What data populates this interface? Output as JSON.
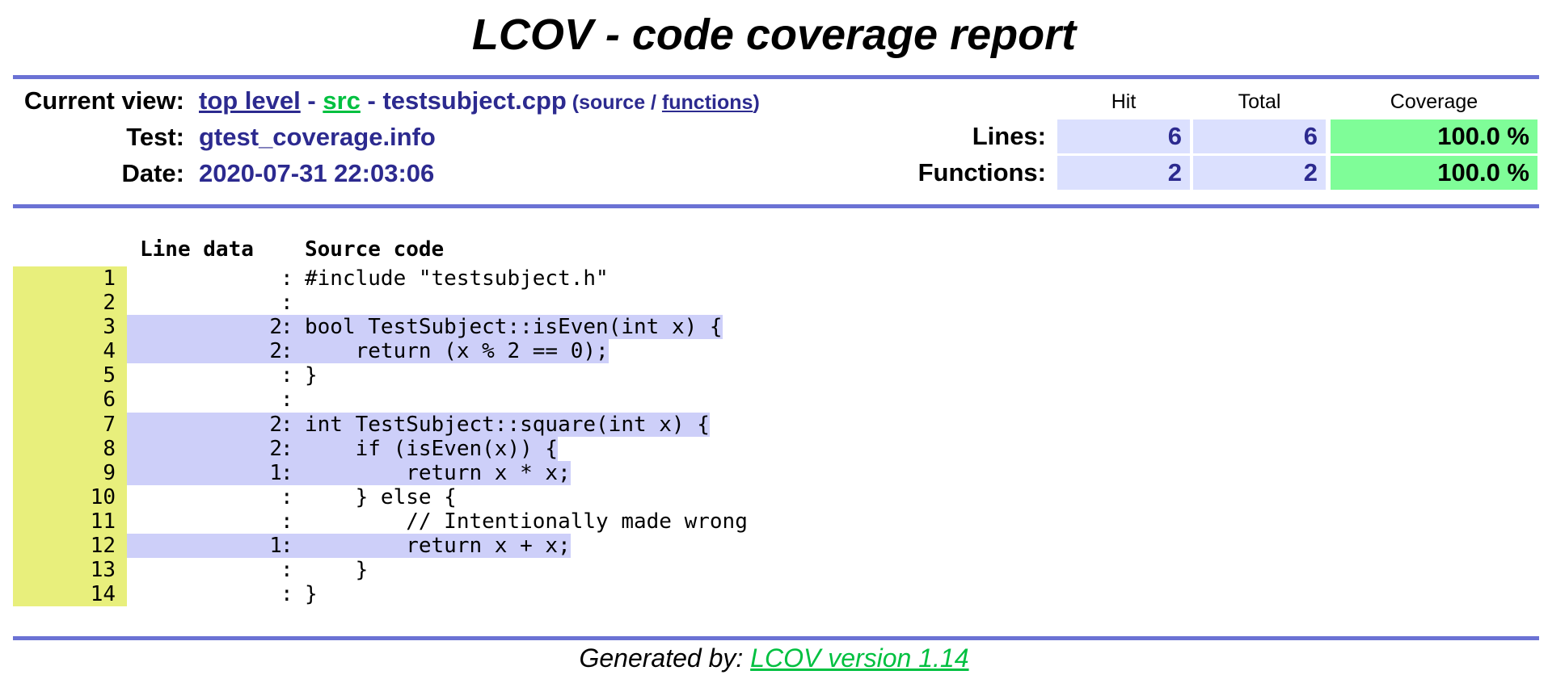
{
  "title": "LCOV - code coverage report",
  "header": {
    "current_view_label": "Current view:",
    "breadcrumb": {
      "top_level": "top level",
      "sep1": " - ",
      "src": "src",
      "sep2": " - ",
      "file": "testsubject.cpp",
      "open_paren": " (",
      "source": "source",
      "slash": " / ",
      "functions": "functions",
      "close_paren": ")"
    },
    "test_label": "Test:",
    "test_value": "gtest_coverage.info",
    "date_label": "Date:",
    "date_value": "2020-07-31 22:03:06"
  },
  "stats": {
    "col_hit": "Hit",
    "col_total": "Total",
    "col_coverage": "Coverage",
    "rows": [
      {
        "label": "Lines:",
        "hit": "6",
        "total": "6",
        "coverage": "100.0 %"
      },
      {
        "label": "Functions:",
        "hit": "2",
        "total": "2",
        "coverage": "100.0 %"
      }
    ]
  },
  "code_header": {
    "line_data": "Line data",
    "source_code": "Source code"
  },
  "code_lines": [
    {
      "num": "1",
      "hits": "",
      "covered": false,
      "src": "#include \"testsubject.h\""
    },
    {
      "num": "2",
      "hits": "",
      "covered": false,
      "src": ""
    },
    {
      "num": "3",
      "hits": "2",
      "covered": true,
      "src": "bool TestSubject::isEven(int x) {"
    },
    {
      "num": "4",
      "hits": "2",
      "covered": true,
      "src": "    return (x % 2 == 0);"
    },
    {
      "num": "5",
      "hits": "",
      "covered": false,
      "src": "}"
    },
    {
      "num": "6",
      "hits": "",
      "covered": false,
      "src": ""
    },
    {
      "num": "7",
      "hits": "2",
      "covered": true,
      "src": "int TestSubject::square(int x) {"
    },
    {
      "num": "8",
      "hits": "2",
      "covered": true,
      "src": "    if (isEven(x)) {"
    },
    {
      "num": "9",
      "hits": "1",
      "covered": true,
      "src": "        return x * x;"
    },
    {
      "num": "10",
      "hits": "",
      "covered": false,
      "src": "    } else {"
    },
    {
      "num": "11",
      "hits": "",
      "covered": false,
      "src": "        // Intentionally made wrong"
    },
    {
      "num": "12",
      "hits": "1",
      "covered": true,
      "src": "        return x + x;"
    },
    {
      "num": "13",
      "hits": "",
      "covered": false,
      "src": "    }"
    },
    {
      "num": "14",
      "hits": "",
      "covered": false,
      "src": "}"
    }
  ],
  "footer": {
    "generated_by": "Generated by: ",
    "lcov_link": "LCOV version 1.14"
  },
  "colors": {
    "rule": "#6b72d4",
    "link_blue": "#2c2a8f",
    "link_green": "#00c040",
    "line_number_bg": "#e8ef7c",
    "covered_bg": "#cdcff9",
    "stat_blue_bg": "#dbe0fe",
    "stat_green_bg": "#7ffd98"
  }
}
